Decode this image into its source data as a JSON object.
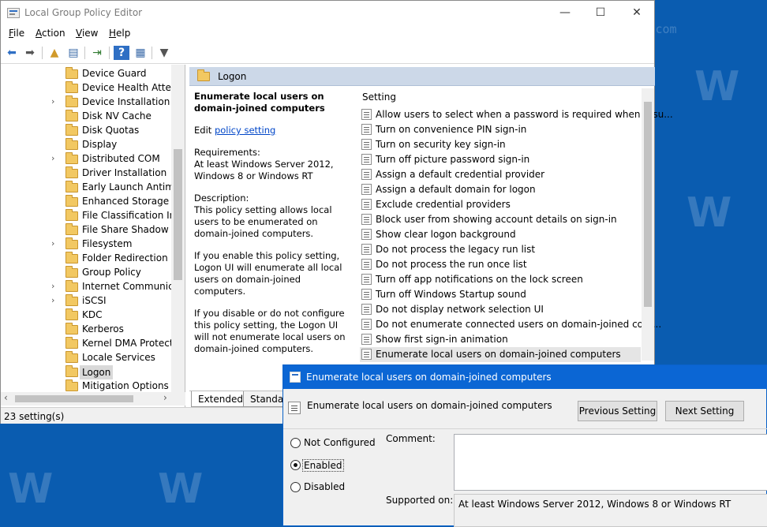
{
  "window": {
    "title": "Local Group Policy Editor",
    "minimize_glyph": "—",
    "maximize_glyph": "☐",
    "close_glyph": "✕"
  },
  "menu": [
    {
      "accel": "F",
      "rest": "ile"
    },
    {
      "accel": "A",
      "rest": "ction"
    },
    {
      "accel": "V",
      "rest": "iew"
    },
    {
      "accel": "H",
      "rest": "elp"
    }
  ],
  "toolbar": {
    "back_glyph": "⬅",
    "forward_glyph": "➡",
    "up_glyph": "▲",
    "show_hide_glyph": "▤",
    "export_glyph": "⇥",
    "help_glyph": "?",
    "properties_glyph": "▦",
    "filter_glyph": "▼"
  },
  "tree": [
    {
      "label": "Device Guard",
      "expandable": false,
      "chev": ""
    },
    {
      "label": "Device Health Attesta",
      "expandable": false,
      "chev": ""
    },
    {
      "label": "Device Installation",
      "expandable": true,
      "chev": "›"
    },
    {
      "label": "Disk NV Cache",
      "expandable": false,
      "chev": ""
    },
    {
      "label": "Disk Quotas",
      "expandable": false,
      "chev": ""
    },
    {
      "label": "Display",
      "expandable": false,
      "chev": ""
    },
    {
      "label": "Distributed COM",
      "expandable": true,
      "chev": "›"
    },
    {
      "label": "Driver Installation",
      "expandable": false,
      "chev": ""
    },
    {
      "label": "Early Launch Antimal",
      "expandable": false,
      "chev": ""
    },
    {
      "label": "Enhanced Storage Ac",
      "expandable": false,
      "chev": ""
    },
    {
      "label": "File Classification Infr",
      "expandable": false,
      "chev": ""
    },
    {
      "label": "File Share Shadow Co",
      "expandable": false,
      "chev": ""
    },
    {
      "label": "Filesystem",
      "expandable": true,
      "chev": "›"
    },
    {
      "label": "Folder Redirection",
      "expandable": false,
      "chev": ""
    },
    {
      "label": "Group Policy",
      "expandable": false,
      "chev": ""
    },
    {
      "label": "Internet Communicat",
      "expandable": true,
      "chev": "›"
    },
    {
      "label": "iSCSI",
      "expandable": true,
      "chev": "›"
    },
    {
      "label": "KDC",
      "expandable": false,
      "chev": ""
    },
    {
      "label": "Kerberos",
      "expandable": false,
      "chev": ""
    },
    {
      "label": "Kernel DMA Protectio",
      "expandable": false,
      "chev": ""
    },
    {
      "label": "Locale Services",
      "expandable": false,
      "chev": ""
    },
    {
      "label": "Logon",
      "expandable": false,
      "chev": "",
      "selected": true
    },
    {
      "label": "Mitigation Options",
      "expandable": false,
      "chev": ""
    }
  ],
  "tree_scroll": {
    "left_glyph": "‹",
    "right_glyph": "›"
  },
  "pane": {
    "title": "Logon",
    "description": {
      "title": "Enumerate local users on domain-joined computers",
      "edit_prefix": "Edit ",
      "edit_link": "policy setting",
      "requirements_label": "Requirements:",
      "requirements": "At least Windows Server 2012, Windows 8 or Windows RT",
      "description_label": "Description:",
      "p1": "This policy setting allows local users to be enumerated on domain-joined computers.",
      "p2": "If you enable this policy setting, Logon UI will enumerate all local users on domain-joined computers.",
      "p3": "If you disable or do not configure this policy setting, the Logon UI will not enumerate local users on domain-joined computers."
    },
    "column_header": "Setting",
    "settings": [
      "Allow users to select when a password is required when resu...",
      "Turn on convenience PIN sign-in",
      "Turn on security key sign-in",
      "Turn off picture password sign-in",
      "Assign a default credential provider",
      "Assign a default domain for logon",
      "Exclude credential providers",
      "Block user from showing account details on sign-in",
      "Show clear logon background",
      "Do not process the legacy run list",
      "Do not process the run once list",
      "Turn off app notifications on the lock screen",
      "Turn off Windows Startup sound",
      "Do not display network selection UI",
      "Do not enumerate connected users on domain-joined com...",
      "Show first sign-in animation",
      "Enumerate local users on domain-joined computers"
    ],
    "tabs": [
      "Extended",
      "Standard"
    ]
  },
  "status": "23 setting(s)",
  "dialog": {
    "title": "Enumerate local users on domain-joined computers",
    "subtitle": "Enumerate local users on domain-joined computers",
    "prev_button": "Previous Setting",
    "next_button": "Next Setting",
    "radio_not_configured": "Not Configured",
    "radio_enabled": "Enabled",
    "radio_disabled": "Disabled",
    "comment_label": "Comment:",
    "supported_label": "Supported on:",
    "supported_value": "At least Windows Server 2012, Windows 8 or Windows RT"
  },
  "colors": {
    "desktop": "#0a5cb0",
    "dialog_title": "#0b66d4",
    "pane_header": "#ccd8e8",
    "link": "#0046c8"
  }
}
